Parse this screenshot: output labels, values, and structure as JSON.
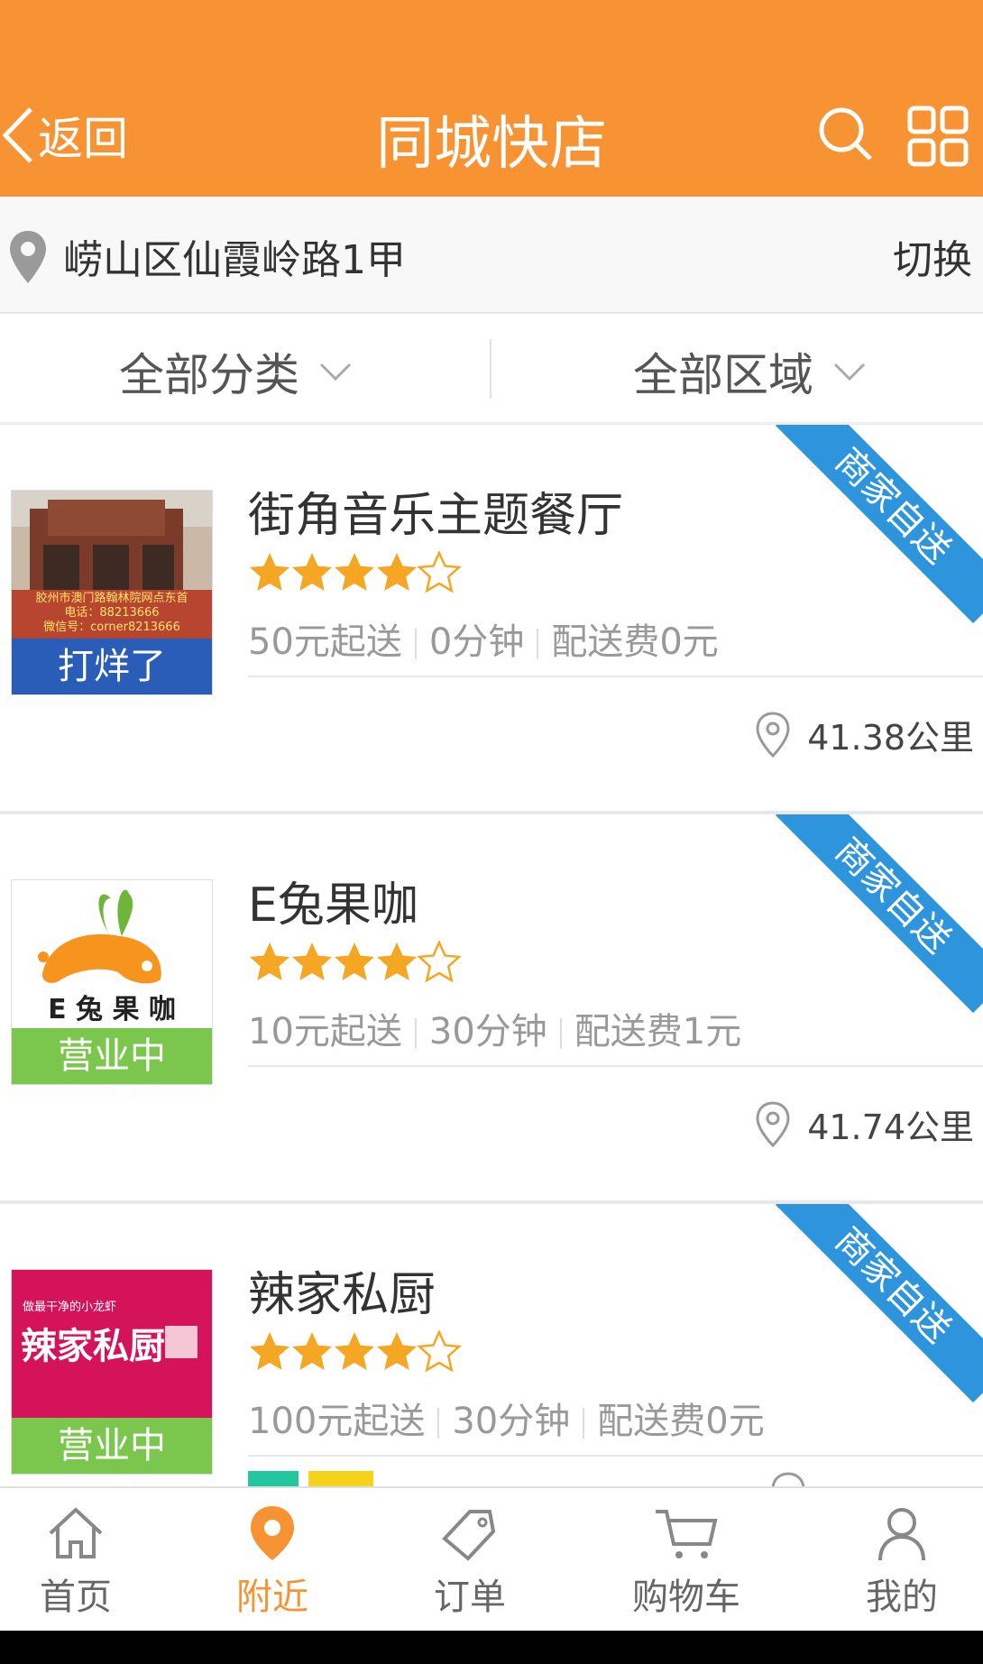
{
  "header": {
    "back_label": "返回",
    "title": "同城快店",
    "bg_color": "#f79332",
    "icons": [
      "search-icon",
      "grid-menu-icon"
    ]
  },
  "location": {
    "address": "崂山区仙霞岭路1甲",
    "switch_label": "切换"
  },
  "filters": {
    "category": "全部分类",
    "region": "全部区域"
  },
  "shops": [
    {
      "name": "街角音乐主题餐厅",
      "rating": 4,
      "min_order": "50元起送",
      "time": "0分钟",
      "delivery_fee": "配送费0元",
      "distance": "41.38公里",
      "status": "打烊了",
      "status_color": "#2a5db8",
      "badge": "商家自送",
      "logo_text": [
        "胶州市澳门路翰林院网点东首",
        "电话：88213666",
        "微信号：corner8213666"
      ]
    },
    {
      "name": "E兔果咖",
      "rating": 4,
      "min_order": "10元起送",
      "time": "30分钟",
      "delivery_fee": "配送费1元",
      "distance": "41.74公里",
      "status": "营业中",
      "status_color": "#7bc74d",
      "badge": "商家自送",
      "logo_text": [
        "E 兔 果 咖"
      ]
    },
    {
      "name": "辣家私厨",
      "rating": 4,
      "min_order": "100元起送",
      "time": "30分钟",
      "delivery_fee": "配送费0元",
      "distance": "",
      "status": "营业中",
      "status_color": "#7bc74d",
      "badge": "商家自送",
      "logo_text": [
        "做最干净的小龙虾",
        "辣家私厨"
      ]
    }
  ],
  "bottom_nav": [
    {
      "label": "首页",
      "icon": "home-icon",
      "active": false
    },
    {
      "label": "附近",
      "icon": "location-pin-icon",
      "active": true
    },
    {
      "label": "订单",
      "icon": "tag-icon",
      "active": false
    },
    {
      "label": "购物车",
      "icon": "cart-icon",
      "active": false
    },
    {
      "label": "我的",
      "icon": "user-icon",
      "active": false
    }
  ],
  "colors": {
    "accent": "#f79332",
    "ribbon": "#2e95dd",
    "star": "#f5a623"
  }
}
